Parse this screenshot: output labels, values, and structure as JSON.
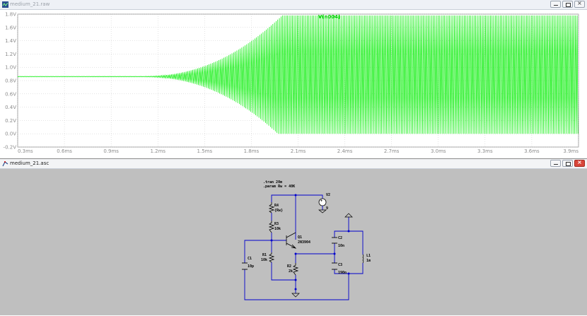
{
  "plot_window": {
    "title": "medium_21.raw",
    "trace_label": "V(n004)"
  },
  "schematic_window": {
    "title": "medium_21.asc",
    "directives": [
      ".tran 20m",
      ".param Rw = 40K"
    ],
    "components": [
      {
        "ref": "V2",
        "value": "9"
      },
      {
        "ref": "R4",
        "value": "{Rw}"
      },
      {
        "ref": "R3",
        "value": "10k"
      },
      {
        "ref": "Q1",
        "value": "2N3904"
      },
      {
        "ref": "C2",
        "value": "10n"
      },
      {
        "ref": "L1",
        "value": "1m"
      },
      {
        "ref": "C1",
        "value": "10p"
      },
      {
        "ref": "R1",
        "value": "10k"
      },
      {
        "ref": "R2",
        "value": "2k"
      },
      {
        "ref": "C3",
        "value": "190n"
      }
    ]
  },
  "colors": {
    "trace": "#00ee00",
    "plot_background": "#ffffff",
    "schematic_background": "#bfbfbf",
    "wire": "#0000cc"
  },
  "icons": [
    "waveform-icon",
    "schematic-icon",
    "minimize-icon",
    "maximize-icon",
    "close-icon"
  ],
  "chart_data": {
    "type": "line",
    "title": "",
    "series": [
      {
        "name": "V(n004)"
      }
    ],
    "x_unit": "ms",
    "y_unit": "V",
    "xlim": [
      0.3,
      3.9
    ],
    "ylim": [
      -0.2,
      1.8
    ],
    "x_ticks": [
      "0.3ms",
      "0.6ms",
      "0.9ms",
      "1.2ms",
      "1.5ms",
      "1.8ms",
      "2.1ms",
      "2.4ms",
      "2.7ms",
      "3.0ms",
      "3.3ms",
      "3.6ms",
      "3.9ms"
    ],
    "y_ticks": [
      "1.8V",
      "1.6V",
      "1.4V",
      "1.2V",
      "1.0V",
      "0.8V",
      "0.6V",
      "0.4V",
      "0.2V",
      "0.0V",
      "-0.2V"
    ],
    "grid": true,
    "envelope": {
      "dc_level": 0.86,
      "oscillation_start_ms": 1.1,
      "saturation_ms": 2.0,
      "max_v": 1.78,
      "min_v": 0.0
    }
  }
}
